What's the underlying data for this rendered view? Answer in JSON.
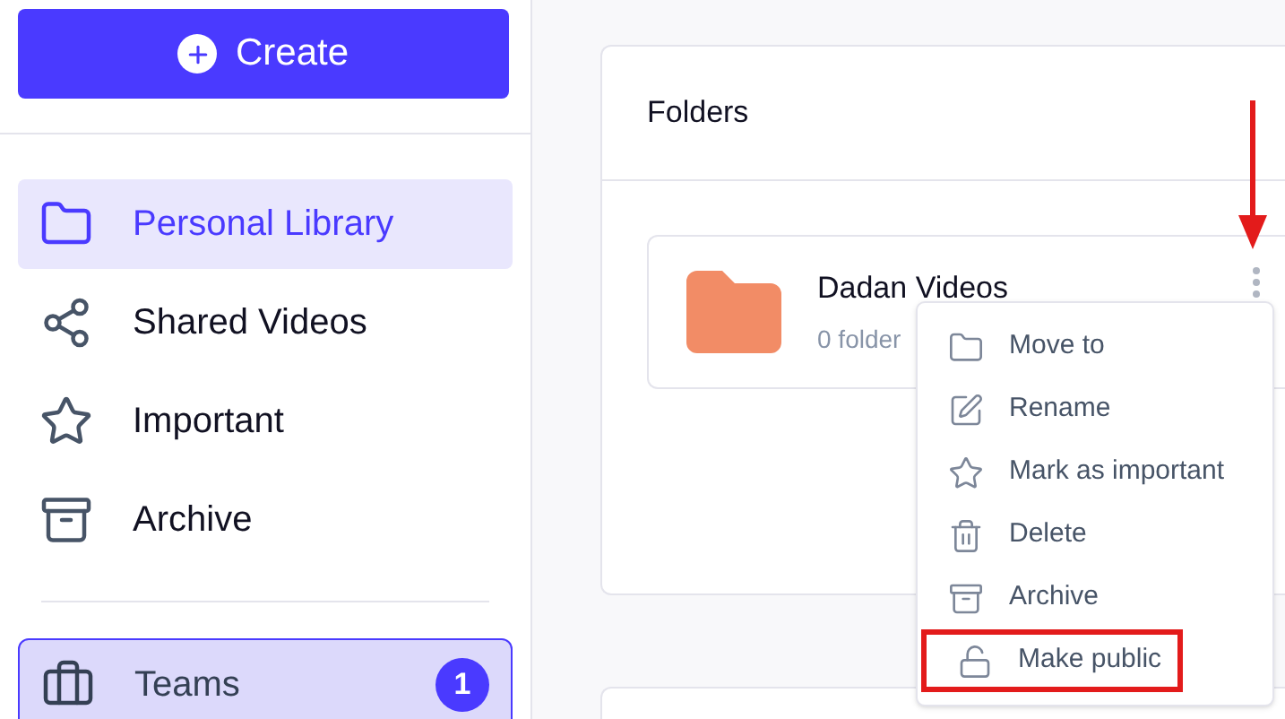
{
  "sidebar": {
    "create_button": "Create",
    "items": [
      {
        "label": "Personal Library",
        "selected": true
      },
      {
        "label": "Shared Videos",
        "selected": false
      },
      {
        "label": "Important",
        "selected": false
      },
      {
        "label": "Archive",
        "selected": false
      }
    ],
    "teams": {
      "label": "Teams",
      "badge": "1"
    }
  },
  "folders_card": {
    "title": "Folders",
    "folder": {
      "name": "Dadan Videos",
      "meta": "0 folder"
    }
  },
  "context_menu": [
    {
      "label": "Move to",
      "highlighted": false
    },
    {
      "label": "Rename",
      "highlighted": false
    },
    {
      "label": "Mark as important",
      "highlighted": false
    },
    {
      "label": "Delete",
      "highlighted": false
    },
    {
      "label": "Archive",
      "highlighted": false
    },
    {
      "label": "Make public",
      "highlighted": true
    }
  ]
}
